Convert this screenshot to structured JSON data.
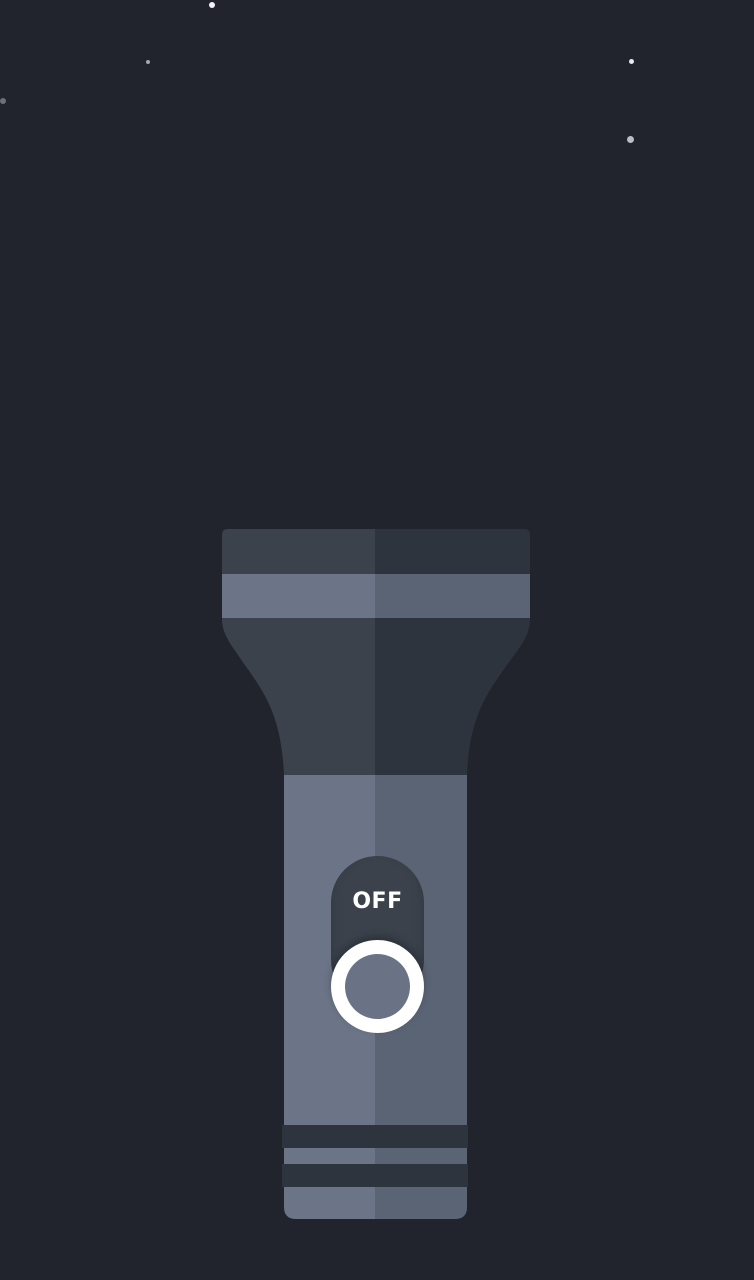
{
  "power_switch": {
    "label": "OFF",
    "state": "off"
  },
  "colors": {
    "background": "#21242d",
    "head_light": "#3c424b",
    "head_dark": "#2e343d",
    "band_light": "#6b7587",
    "band_dark": "#5a6475",
    "handle_light": "#6b7587",
    "handle_dark": "#5a6475",
    "toggle_track": "#3b424c",
    "toggle_knob": "#ffffff"
  },
  "icons": {
    "power_knob": "circle-ring-icon"
  }
}
